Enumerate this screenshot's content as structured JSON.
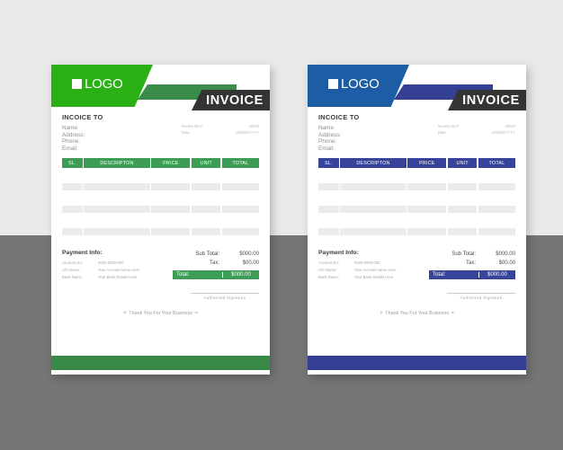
{
  "background": {
    "top_color": "#e9e9e9",
    "bottom_color": "#757575"
  },
  "common": {
    "logo_text": "LOGO",
    "invoice_banner": "INVOICE",
    "billto_title": "INCOICE TO",
    "billto_lines": [
      "Name",
      "Address:",
      "Phone:",
      "Email:"
    ],
    "meta": [
      {
        "label": "Invoice No:#",
        "value": "00000"
      },
      {
        "label": "Date",
        "value": "DD/MM/YYYY"
      }
    ],
    "table_headers": [
      "SL.",
      "DESCRIPTON",
      "PRICE",
      "UNIT",
      "TOTAL"
    ],
    "table_row_count": 3,
    "payment_title": "Payment Info:",
    "payment_rows": [
      {
        "label": "Account No:",
        "value": "0000-0000-000"
      },
      {
        "label": "A/C Name:",
        "value": "Your Account name Here"
      },
      {
        "label": "Bank Name:",
        "value": "Your Bank Details Here"
      }
    ],
    "totals": [
      {
        "label": "Sub Total:",
        "value": "$000.00"
      },
      {
        "label": "Tax:",
        "value": "$00.00"
      }
    ],
    "total_final": {
      "label": "Total:",
      "value": "$000.00"
    },
    "signature_label": "Authorized Signature",
    "thanks_text": "Thank You For Your Business",
    "flourish_left": "⚘",
    "flourish_right": "❧"
  },
  "variants": [
    {
      "id": "green",
      "name": "green-invoice-card",
      "logo_block_color": "#2ab015",
      "accent_color": "#3b8c4b",
      "banner_color": "#343434",
      "table_header_color": "#3d9c55",
      "total_bar_color": "#3d9c55",
      "footer_color": "#398a46"
    },
    {
      "id": "blue",
      "name": "blue-invoice-card",
      "logo_block_color": "#1c5da5",
      "accent_color": "#353f94",
      "banner_color": "#343434",
      "table_header_color": "#38439a",
      "total_bar_color": "#38439a",
      "footer_color": "#353f94"
    }
  ]
}
